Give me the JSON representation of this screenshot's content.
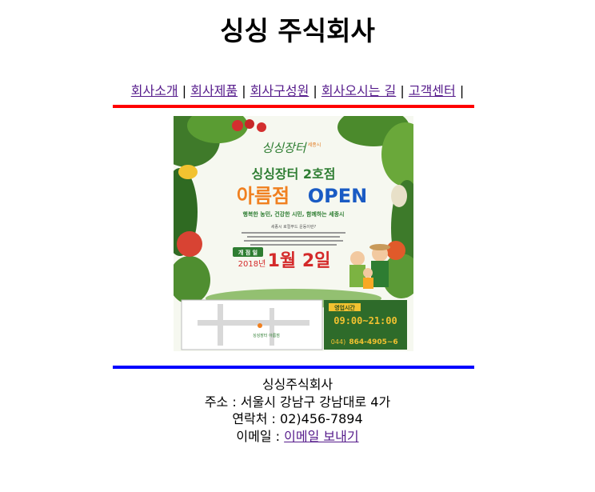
{
  "header": {
    "title": "싱싱 주식회사"
  },
  "nav": {
    "items": [
      {
        "label": "회사소개"
      },
      {
        "label": "회사제품"
      },
      {
        "label": "회사구성원"
      },
      {
        "label": "회사오시는 길"
      },
      {
        "label": "고객센터"
      }
    ],
    "separator": "|"
  },
  "poster": {
    "logo_text": "싱싱장터",
    "logo_sub": "세종시",
    "branch_title": "싱싱장터 2호점",
    "store_name": "아름점",
    "open_word": "OPEN",
    "slogan": "행복한 농민, 건강한 시민, 함께하는 세종시",
    "notice_heading": "세종시 로컬푸드 운동이란?",
    "open_date_label": "개 점 일",
    "open_year": "2018년",
    "open_date": "1월 2일",
    "hours_label": "영업시간",
    "hours": "09:00~21:00",
    "phone_prefix": "044)",
    "phone": "864-4905~6",
    "map_marker_label": "싱싱장터 아름점"
  },
  "footer": {
    "company": "싱싱주식회사",
    "address": "주소 : 서울시 강남구 강남대로 4가",
    "phone": "연락처 : 02)456-7894",
    "email_label": "이메일 : ",
    "email_link": "이메일 보내기"
  },
  "colors": {
    "top_rule": "#ff0000",
    "bottom_rule": "#0000ff",
    "link": "#551a8b",
    "poster_red": "#d42a2a",
    "poster_orange": "#f08020",
    "poster_blue": "#1a5bc4",
    "poster_green": "#2e7d32"
  }
}
